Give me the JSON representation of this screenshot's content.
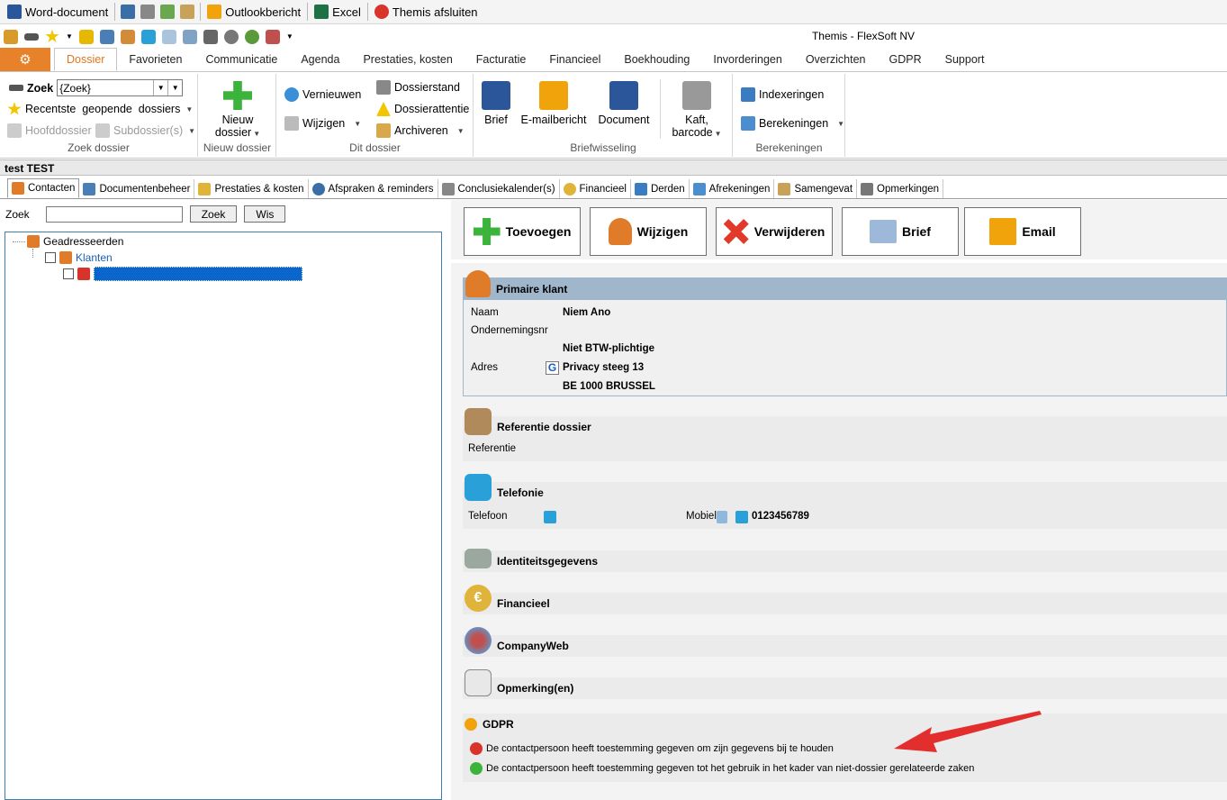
{
  "topbar": {
    "word": "Word-document",
    "outlook": "Outlookbericht",
    "excel": "Excel",
    "close": "Themis afsluiten"
  },
  "window": {
    "title": "Themis - FlexSoft NV"
  },
  "ribbon_tabs": [
    "Dossier",
    "Favorieten",
    "Communicatie",
    "Agenda",
    "Prestaties, kosten",
    "Facturatie",
    "Financieel",
    "Boekhouding",
    "Invorderingen",
    "Overzichten",
    "GDPR",
    "Support"
  ],
  "ribbon": {
    "zoek_label": "Zoek",
    "zoek_value": "{Zoek}",
    "recent": "Recentste  geopende  dossiers",
    "hoofddossier": "Hoofddossier",
    "subdossier": "Subdossier(s)",
    "grp_zoek": "Zoek dossier",
    "nieuw_line1": "Nieuw",
    "nieuw_line2": "dossier",
    "grp_nieuw": "Nieuw dossier",
    "vernieuwen": "Vernieuwen",
    "wijzigen": "Wijzigen",
    "dossierstand": "Dossierstand",
    "dossierattentie": "Dossierattentie",
    "archiveren": "Archiveren",
    "grp_dit": "Dit dossier",
    "brief": "Brief",
    "emailbericht": "E-mailbericht",
    "document": "Document",
    "kaft_line1": "Kaft,",
    "kaft_line2": "barcode",
    "grp_brief": "Briefwisseling",
    "indexeringen": "Indexeringen",
    "berekeningen": "Berekeningen",
    "grp_ber": "Berekeningen"
  },
  "dossier_title": "test TEST",
  "content_tabs": [
    "Contacten",
    "Documentenbeheer",
    "Prestaties & kosten",
    "Afspraken & reminders",
    "Conclusiekalender(s)",
    "Financieel",
    "Derden",
    "Afrekeningen",
    "Samengevat",
    "Opmerkingen"
  ],
  "left": {
    "zoek_label": "Zoek",
    "zoek_btn": "Zoek",
    "wis_btn": "Wis",
    "tree_root": "Geadresseerden",
    "tree_klanten": "Klanten"
  },
  "actions": {
    "toevoegen": "Toevoegen",
    "wijzigen": "Wijzigen",
    "verwijderen": "Verwijderen",
    "brief": "Brief",
    "email": "Email"
  },
  "primaire": {
    "title": "Primaire klant",
    "naam_label": "Naam",
    "naam": "Niem Ano",
    "onderneming_label": "Ondernemingsnr",
    "btw": "Niet BTW-plichtige",
    "adres_label": "Adres",
    "adres1": "Privacy steeg 13",
    "adres2": "BE 1000 BRUSSEL"
  },
  "referentie": {
    "title": "Referentie dossier",
    "label": "Referentie"
  },
  "telefonie": {
    "title": "Telefonie",
    "telefoon_label": "Telefoon",
    "mobiel_label": "Mobiel",
    "mobiel": "0123456789"
  },
  "identiteit": {
    "title": "Identiteitsgegevens"
  },
  "financieel": {
    "title": "Financieel"
  },
  "companyweb": {
    "title": "CompanyWeb"
  },
  "opmerking": {
    "title": "Opmerking(en)"
  },
  "gdpr": {
    "title": "GDPR",
    "line1": "De contactpersoon heeft toestemming gegeven om zijn gegevens bij te houden",
    "line2": "De contactpersoon heeft toestemming gegeven tot het gebruik in het kader van niet-dossier gerelateerde zaken"
  },
  "colors": {
    "accent": "#e8822a",
    "section_header": "#9fb6cb",
    "selection": "#0a66cc"
  }
}
